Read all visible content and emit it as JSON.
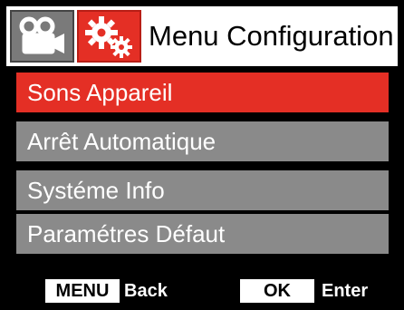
{
  "header": {
    "title": "Menu Configuration",
    "tabs": [
      {
        "icon": "video-camera-icon",
        "active": false
      },
      {
        "icon": "settings-gears-icon",
        "active": true
      }
    ]
  },
  "menu": {
    "items": [
      {
        "label": "Sons Appareil",
        "selected": true
      },
      {
        "label": "Arrêt Automatique",
        "selected": false
      },
      {
        "label": "Systéme Info",
        "selected": false
      },
      {
        "label": "Paramétres Défaut",
        "selected": false
      }
    ]
  },
  "footer": {
    "menu_key": "MENU",
    "menu_action": "Back",
    "ok_key": "OK",
    "ok_action": "Enter"
  },
  "colors": {
    "background": "#000000",
    "header_background": "#ffffff",
    "selected": "#e42f25",
    "unselected": "#8a8a8a",
    "inactive_tab": "#7a7a7a"
  }
}
